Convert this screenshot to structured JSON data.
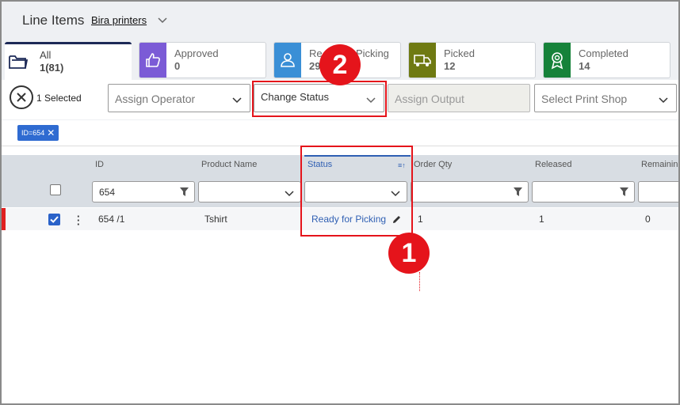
{
  "header": {
    "title": "Line Items",
    "client": "Bira printers"
  },
  "status_cards": [
    {
      "label": "All",
      "count": "1(81)",
      "color": "#1d2a57",
      "icon": "folder-icon"
    },
    {
      "label": "Approved",
      "count": "0",
      "color": "#7b5bd6",
      "icon": "thumbs-up-icon"
    },
    {
      "label": "Ready for Picking",
      "label_visible": "Re",
      "label_visible_end": "Picking",
      "count": "29",
      "color": "#3a8fd6",
      "icon": "person-icon"
    },
    {
      "label": "Picked",
      "count": "12",
      "color": "#6f7a12",
      "icon": "truck-icon"
    },
    {
      "label": "Completed",
      "count": "14",
      "color": "#16823a",
      "icon": "award-icon"
    }
  ],
  "toolbar": {
    "selected": "1 Selected",
    "assign_operator": "Assign Operator",
    "change_status": "Change Status",
    "assign_output": "Assign Output",
    "select_print_shop": "Select Print Shop"
  },
  "filter_chip": "ID=654",
  "grid": {
    "columns": [
      "ID",
      "Product Name",
      "Status",
      "Order Qty",
      "Released",
      "Remaining"
    ],
    "filters": {
      "id": "654"
    },
    "rows": [
      {
        "id": "654 /1",
        "product": "Tshirt",
        "status": "Ready for Picking",
        "order_qty": "1",
        "released": "1",
        "remaining": "0"
      }
    ]
  },
  "annotations": {
    "badge1": "1",
    "badge2": "2"
  }
}
